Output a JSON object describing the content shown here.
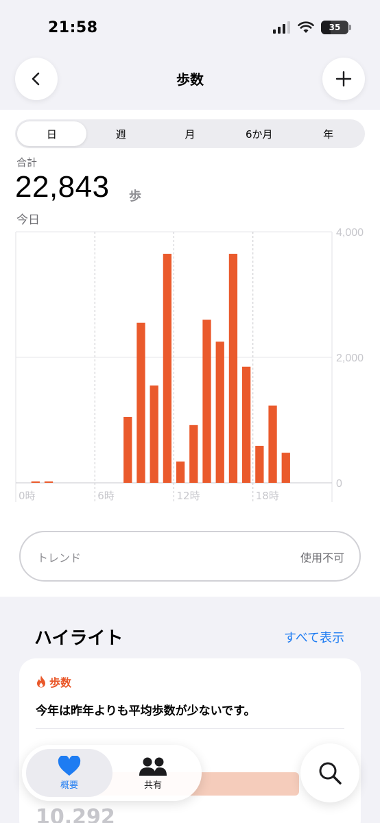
{
  "status": {
    "time": "21:58",
    "battery": "35",
    "battery_level": 0.35
  },
  "nav": {
    "title": "歩数",
    "back_icon": "chevron-left-icon",
    "add_icon": "plus-icon"
  },
  "segments": [
    {
      "label": "日",
      "active": true
    },
    {
      "label": "週",
      "active": false
    },
    {
      "label": "月",
      "active": false
    },
    {
      "label": "6か月",
      "active": false
    },
    {
      "label": "年",
      "active": false
    }
  ],
  "summary": {
    "label": "合計",
    "value": "22,843",
    "unit": "歩",
    "date": "今日"
  },
  "chart_data": {
    "type": "bar",
    "x": [
      0,
      1,
      2,
      3,
      4,
      5,
      6,
      7,
      8,
      9,
      10,
      11,
      12,
      13,
      14,
      15,
      16,
      17,
      18,
      19,
      20,
      21,
      22,
      23
    ],
    "values": [
      0,
      20,
      20,
      0,
      0,
      0,
      0,
      0,
      1050,
      2550,
      1550,
      3650,
      340,
      920,
      2600,
      2250,
      3650,
      1850,
      590,
      1230,
      480,
      0,
      0,
      0
    ],
    "xtick_labels": [
      "0時",
      "6時",
      "12時",
      "18時"
    ],
    "xtick_positions": [
      0,
      6,
      12,
      18
    ],
    "yticks": [
      "4,000",
      "2,000",
      "0"
    ],
    "ytick_values": [
      4000,
      2000,
      0
    ],
    "ylim": [
      0,
      4000
    ],
    "color": "#ea5a2c",
    "grid": true
  },
  "trend": {
    "label": "トレンド",
    "value": "使用不可"
  },
  "highlights": {
    "title": "ハイライト",
    "show_all": "すべて表示",
    "card": {
      "tag": "歩数",
      "tag_icon": "flame-icon",
      "text": "今年は昨年よりも平均歩数が少ないです。",
      "partial_value": "10,292"
    }
  },
  "tabs": [
    {
      "label": "概要",
      "icon": "heart-icon",
      "active": true
    },
    {
      "label": "共有",
      "icon": "people-icon",
      "active": false
    }
  ],
  "search": {
    "icon": "search-icon"
  }
}
